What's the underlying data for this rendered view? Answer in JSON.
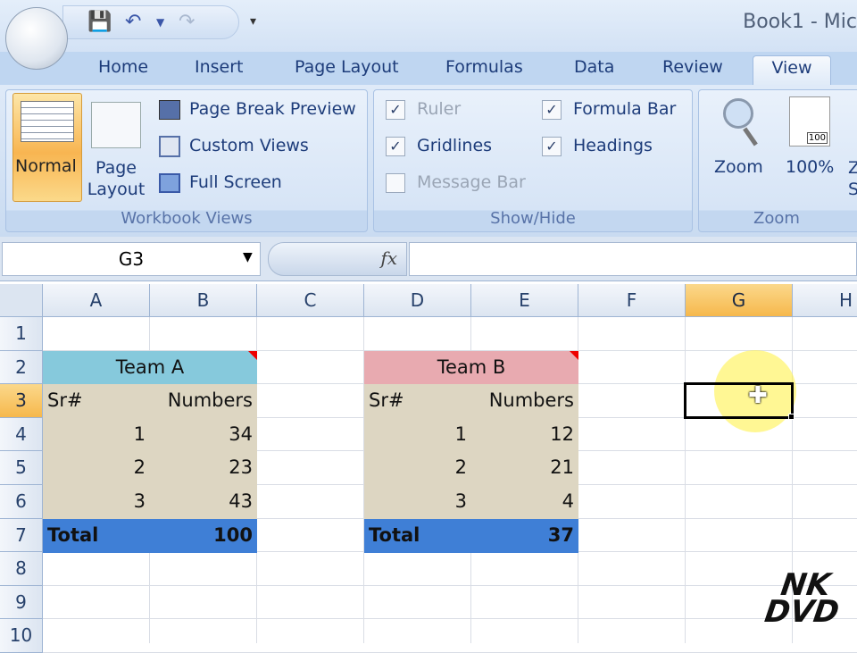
{
  "window": {
    "title": "Book1 - Mic"
  },
  "tabs": [
    {
      "label": "Home"
    },
    {
      "label": "Insert"
    },
    {
      "label": "Page Layout"
    },
    {
      "label": "Formulas"
    },
    {
      "label": "Data"
    },
    {
      "label": "Review"
    },
    {
      "label": "View"
    }
  ],
  "ribbon": {
    "workbook_views": {
      "label": "Workbook Views",
      "normal": "Normal",
      "page_layout_1": "Page",
      "page_layout_2": "Layout",
      "page_break": "Page Break Preview",
      "custom_views": "Custom Views",
      "full_screen": "Full Screen"
    },
    "show_hide": {
      "label": "Show/Hide",
      "ruler": "Ruler",
      "ruler_checked": true,
      "gridlines": "Gridlines",
      "gridlines_checked": true,
      "message_bar": "Message Bar",
      "message_bar_checked": false,
      "formula_bar": "Formula Bar",
      "formula_bar_checked": true,
      "headings": "Headings",
      "headings_checked": true
    },
    "zoom": {
      "label": "Zoom",
      "zoom": "Zoom",
      "hundred": "100%",
      "hundred_icon": "100",
      "partial_1": "Z",
      "partial_2": "S"
    }
  },
  "formula_bar": {
    "name_box": "G3",
    "fx": "fx",
    "value": ""
  },
  "columns": [
    "A",
    "B",
    "C",
    "D",
    "E",
    "F",
    "G",
    "H"
  ],
  "rows": [
    "1",
    "2",
    "3",
    "4",
    "5",
    "6",
    "7",
    "8",
    "9",
    "10"
  ],
  "selected_cell": "G3",
  "team_a": {
    "title": "Team A",
    "h1": "Sr#",
    "h2": "Numbers",
    "data": [
      [
        "1",
        "34"
      ],
      [
        "2",
        "23"
      ],
      [
        "3",
        "43"
      ]
    ],
    "total_label": "Total",
    "total": "100"
  },
  "team_b": {
    "title": "Team B",
    "h1": "Sr#",
    "h2": "Numbers",
    "data": [
      [
        "1",
        "12"
      ],
      [
        "2",
        "21"
      ],
      [
        "3",
        "4"
      ]
    ],
    "total_label": "Total",
    "total": "37"
  },
  "watermark": "NK DVD",
  "colors": {
    "team_a_header": "#86c9dc",
    "team_b_header": "#e8aab0",
    "body": "#ddd6c2",
    "total": "#3f7fd6"
  }
}
